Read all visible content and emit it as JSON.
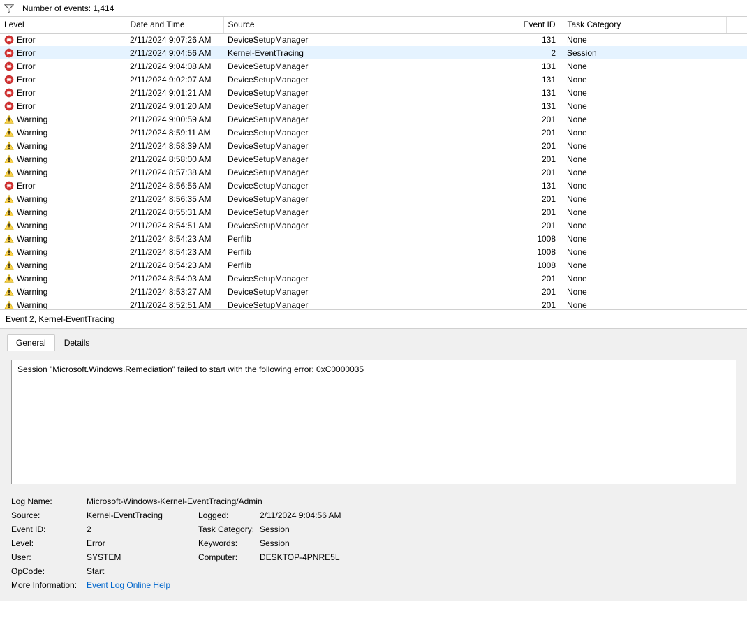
{
  "header": {
    "event_count_label": "Number of events: 1,414"
  },
  "columns": {
    "level": "Level",
    "date": "Date and Time",
    "source": "Source",
    "eventid": "Event ID",
    "taskcat": "Task Category"
  },
  "events": [
    {
      "level": "Error",
      "date": "2/11/2024 9:07:26 AM",
      "source": "DeviceSetupManager",
      "id": "131",
      "taskcat": "None",
      "sel": false
    },
    {
      "level": "Error",
      "date": "2/11/2024 9:04:56 AM",
      "source": "Kernel-EventTracing",
      "id": "2",
      "taskcat": "Session",
      "sel": true
    },
    {
      "level": "Error",
      "date": "2/11/2024 9:04:08 AM",
      "source": "DeviceSetupManager",
      "id": "131",
      "taskcat": "None",
      "sel": false
    },
    {
      "level": "Error",
      "date": "2/11/2024 9:02:07 AM",
      "source": "DeviceSetupManager",
      "id": "131",
      "taskcat": "None",
      "sel": false
    },
    {
      "level": "Error",
      "date": "2/11/2024 9:01:21 AM",
      "source": "DeviceSetupManager",
      "id": "131",
      "taskcat": "None",
      "sel": false
    },
    {
      "level": "Error",
      "date": "2/11/2024 9:01:20 AM",
      "source": "DeviceSetupManager",
      "id": "131",
      "taskcat": "None",
      "sel": false
    },
    {
      "level": "Warning",
      "date": "2/11/2024 9:00:59 AM",
      "source": "DeviceSetupManager",
      "id": "201",
      "taskcat": "None",
      "sel": false
    },
    {
      "level": "Warning",
      "date": "2/11/2024 8:59:11 AM",
      "source": "DeviceSetupManager",
      "id": "201",
      "taskcat": "None",
      "sel": false
    },
    {
      "level": "Warning",
      "date": "2/11/2024 8:58:39 AM",
      "source": "DeviceSetupManager",
      "id": "201",
      "taskcat": "None",
      "sel": false
    },
    {
      "level": "Warning",
      "date": "2/11/2024 8:58:00 AM",
      "source": "DeviceSetupManager",
      "id": "201",
      "taskcat": "None",
      "sel": false
    },
    {
      "level": "Warning",
      "date": "2/11/2024 8:57:38 AM",
      "source": "DeviceSetupManager",
      "id": "201",
      "taskcat": "None",
      "sel": false
    },
    {
      "level": "Error",
      "date": "2/11/2024 8:56:56 AM",
      "source": "DeviceSetupManager",
      "id": "131",
      "taskcat": "None",
      "sel": false
    },
    {
      "level": "Warning",
      "date": "2/11/2024 8:56:35 AM",
      "source": "DeviceSetupManager",
      "id": "201",
      "taskcat": "None",
      "sel": false
    },
    {
      "level": "Warning",
      "date": "2/11/2024 8:55:31 AM",
      "source": "DeviceSetupManager",
      "id": "201",
      "taskcat": "None",
      "sel": false
    },
    {
      "level": "Warning",
      "date": "2/11/2024 8:54:51 AM",
      "source": "DeviceSetupManager",
      "id": "201",
      "taskcat": "None",
      "sel": false
    },
    {
      "level": "Warning",
      "date": "2/11/2024 8:54:23 AM",
      "source": "Perflib",
      "id": "1008",
      "taskcat": "None",
      "sel": false
    },
    {
      "level": "Warning",
      "date": "2/11/2024 8:54:23 AM",
      "source": "Perflib",
      "id": "1008",
      "taskcat": "None",
      "sel": false
    },
    {
      "level": "Warning",
      "date": "2/11/2024 8:54:23 AM",
      "source": "Perflib",
      "id": "1008",
      "taskcat": "None",
      "sel": false
    },
    {
      "level": "Warning",
      "date": "2/11/2024 8:54:03 AM",
      "source": "DeviceSetupManager",
      "id": "201",
      "taskcat": "None",
      "sel": false
    },
    {
      "level": "Warning",
      "date": "2/11/2024 8:53:27 AM",
      "source": "DeviceSetupManager",
      "id": "201",
      "taskcat": "None",
      "sel": false
    },
    {
      "level": "Warning",
      "date": "2/11/2024 8:52:51 AM",
      "source": "DeviceSetupManager",
      "id": "201",
      "taskcat": "None",
      "sel": false
    }
  ],
  "detail": {
    "title": "Event 2, Kernel-EventTracing",
    "tabs": {
      "general": "General",
      "details": "Details"
    },
    "message": "Session \"Microsoft.Windows.Remediation\" failed to start with the following error: 0xC0000035",
    "props": {
      "logname_label": "Log Name:",
      "logname_value": "Microsoft-Windows-Kernel-EventTracing/Admin",
      "source_label": "Source:",
      "source_value": "Kernel-EventTracing",
      "logged_label": "Logged:",
      "logged_value": "2/11/2024 9:04:56 AM",
      "eventid_label": "Event ID:",
      "eventid_value": "2",
      "taskcat_label": "Task Category:",
      "taskcat_value": "Session",
      "level_label": "Level:",
      "level_value": "Error",
      "keywords_label": "Keywords:",
      "keywords_value": "Session",
      "user_label": "User:",
      "user_value": "SYSTEM",
      "computer_label": "Computer:",
      "computer_value": "DESKTOP-4PNRE5L",
      "opcode_label": "OpCode:",
      "opcode_value": "Start",
      "moreinfo_label": "More Information:",
      "moreinfo_link": "Event Log Online Help"
    }
  }
}
